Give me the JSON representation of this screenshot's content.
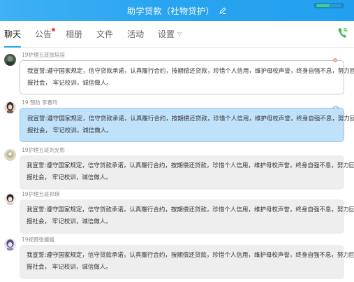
{
  "titlebar": {
    "title": "助学贷款（社物贷护）"
  },
  "tabs": [
    {
      "label": "聊天"
    },
    {
      "label": "公告"
    },
    {
      "label": "相册"
    },
    {
      "label": "文件"
    },
    {
      "label": "活动"
    },
    {
      "label": "设置"
    }
  ],
  "colors": {
    "accent": "#2aa4f0",
    "titlebar": "#2aa4f0",
    "call": "#3dbb4f",
    "blue_bubble": "#bfe1fa",
    "unread_dot": "#f04848"
  },
  "messages": [
    {
      "sender": "19护理五班张培培",
      "line1": "我宣誓:遵守国家规定，信守贷款承诺，认真履行合约，按期偿还贷款，珍惜个人信用，维护母校声誉，终身自强不息，努力回",
      "line2": "报社会，  牢记校训，诚信做人。",
      "style": "white"
    },
    {
      "sender": "19 预防 李春玲",
      "line1": "我宣誓:遵守国家规定，信守贷款承诺，认真履行合约，按期偿还贷款，珍惜个人信用，维护母校声誉，终身自强不息，努力回",
      "line2": "报社会，  牢记校训，诚信做人。",
      "style": "blue"
    },
    {
      "sender": "19护理五班刘光影",
      "line1": "我宣誓:遵守国家规定，信守贷款承诺，认真履行合约，按期偿还贷款，珍惜个人信用，维护母校声誉，终身自强不息，努力回",
      "line2": "报社会，  牢记校训，诚信做人。",
      "style": "gray"
    },
    {
      "sender": "19护理五班祁琪",
      "line1": "我宣誓:遵守国家规定，信守贷款承诺，认真履行合约，按期偿还贷款，珍惜个人信用，维护母校声誉，终身自强不息，努力回",
      "line2": "报社会，  牢记校训，诚信做人。",
      "style": "gray"
    },
    {
      "sender": "19视预张媛媛",
      "line1": "我宣誓:遵守国家规定，信守贷款承诺，认真履行合约，按期偿还贷款，珍惜个人信用，维护母校声誉，终身自强不息，努力回",
      "line2": "报社会，  牢记校训，诚信做人。",
      "style": "gray"
    }
  ]
}
